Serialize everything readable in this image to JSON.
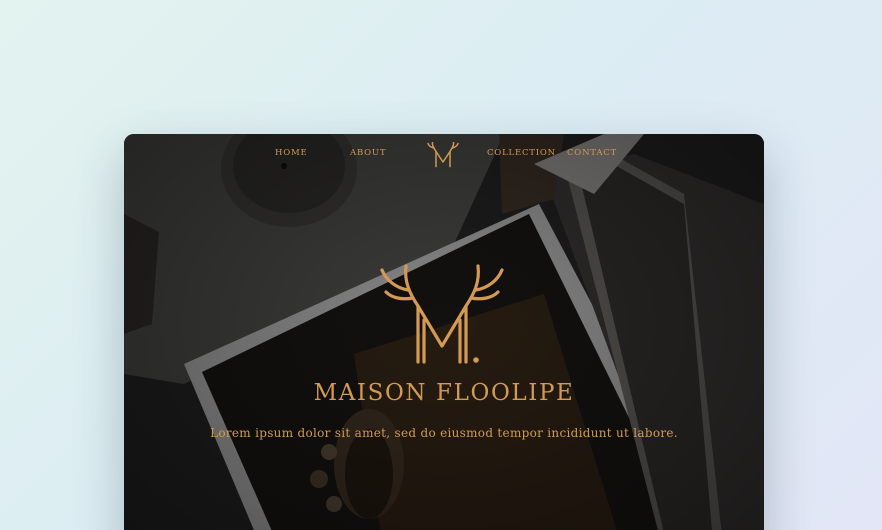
{
  "nav": {
    "items": [
      {
        "label": "HOME"
      },
      {
        "label": "ABOUT"
      },
      {
        "label": "COLLECTION"
      },
      {
        "label": "CONTACT"
      }
    ],
    "logo_icon": "antler-m-monogram-icon"
  },
  "hero": {
    "logo_icon": "antler-m-monogram-icon",
    "brand_name": "MAISON FLOOLIPE",
    "tagline": "Lorem ipsum dolor sit amet, sed do eiusmod tempor incididunt ut labore."
  },
  "colors": {
    "accent": "#d49a55",
    "overlay": "#141414",
    "page_background": "#e0eff2"
  }
}
